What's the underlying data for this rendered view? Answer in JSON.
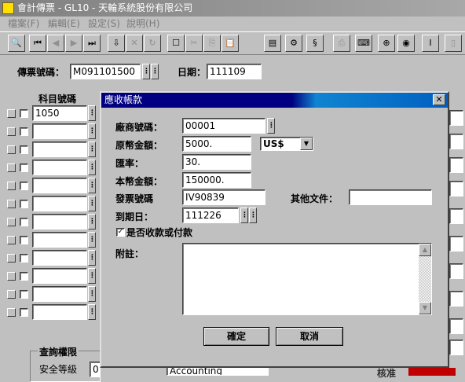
{
  "window": {
    "title": "會計傳票 - GL10 - 天輪系統股份有限公司"
  },
  "menu": [
    "檔案(F)",
    "編輯(E)",
    "設定(S)",
    "說明(H)"
  ],
  "toolbar": {
    "icons": [
      "search-icon",
      "first-record-icon",
      "prev-record-icon",
      "next-record-icon",
      "last-record-icon",
      "save-icon",
      "delete-icon",
      "refresh-icon",
      "new-icon",
      "cut-icon",
      "copy-icon",
      "paste-icon",
      "form-icon",
      "network-icon",
      "document-icon",
      "print-icon",
      "keyboard-icon",
      "zoom-in-icon",
      "find-icon",
      "text-icon",
      "exit-icon"
    ],
    "glyphs": [
      "🔍",
      "⏮",
      "◀",
      "▶",
      "⏭",
      "⇩",
      "✕",
      "↻",
      "☐",
      "✂",
      "⎘",
      "📋",
      "▤",
      "⚙",
      "§",
      "⎙",
      "⌨",
      "⊕",
      "◉",
      "Ⅰ",
      "▯"
    ]
  },
  "form": {
    "voucher_label": "傳票號碼：",
    "voucher_no": "M091101500",
    "date_label": "日期：",
    "date": "111109",
    "account_header": "科目號碼",
    "first_account": "1050",
    "query_group_label": "查詢權限",
    "security_label": "安全等級",
    "security_value": "0",
    "bottom_field": "Accounting",
    "bottom_right_label": "核准"
  },
  "dialog": {
    "title": "應收帳款",
    "vendor_label": "廠商號碼：",
    "vendor_value": "00001",
    "orig_amount_label": "原幣金額：",
    "orig_amount_value": "5000.",
    "currency_value": "US$",
    "rate_label": "匯率：",
    "rate_value": "30.",
    "local_amount_label": "本幣金額：",
    "local_amount_value": "150000.",
    "invoice_label": "發票號碼",
    "invoice_value": "IV90839",
    "other_doc_label": "其他文件：",
    "other_doc_value": "",
    "due_label": "到期日：",
    "due_value": "111226",
    "checkbox_label": "是否收款或付款",
    "checkbox_checked": "✓",
    "note_label": "附註：",
    "note_value": "",
    "ok_label": "確定",
    "cancel_label": "取消"
  }
}
